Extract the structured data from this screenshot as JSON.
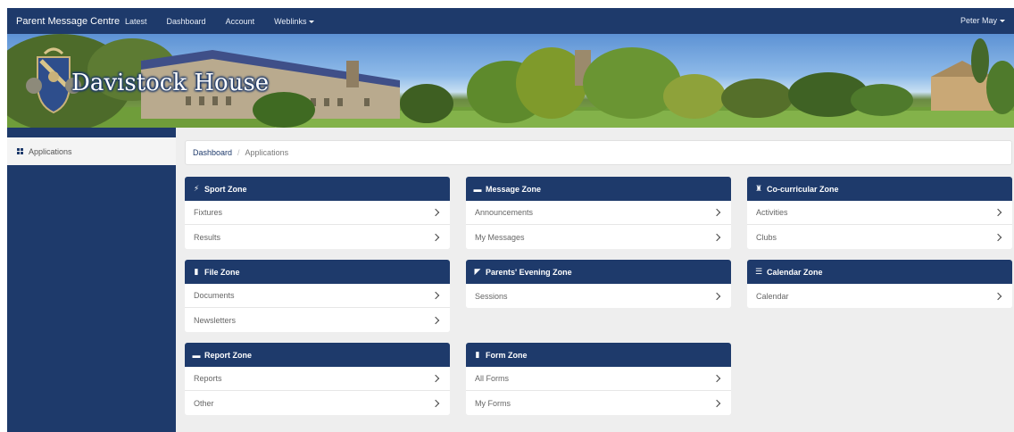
{
  "navbar": {
    "brand": "Parent Message Centre",
    "items": [
      "Latest",
      "Dashboard",
      "Account",
      "Weblinks"
    ],
    "user": "Peter May"
  },
  "banner": {
    "title": "Davistock House"
  },
  "sidebar": {
    "items": [
      {
        "label": "Applications",
        "icon": "grid-icon"
      }
    ]
  },
  "breadcrumb": [
    "Dashboard",
    "Applications"
  ],
  "zones": [
    {
      "title": "Sport Zone",
      "icon": "bolt-icon",
      "items": [
        "Fixtures",
        "Results"
      ]
    },
    {
      "title": "Message Zone",
      "icon": "comment-icon",
      "items": [
        "Announcements",
        "My Messages"
      ]
    },
    {
      "title": "Co-curricular Zone",
      "icon": "trophy-icon",
      "items": [
        "Activities",
        "Clubs"
      ]
    },
    {
      "title": "File Zone",
      "icon": "file-icon",
      "items": [
        "Documents",
        "Newsletters"
      ]
    },
    {
      "title": "Parents' Evening Zone",
      "icon": "bullhorn-icon",
      "items": [
        "Sessions"
      ]
    },
    {
      "title": "Calendar Zone",
      "icon": "calendar-icon",
      "items": [
        "Calendar"
      ]
    },
    {
      "title": "Report Zone",
      "icon": "briefcase-icon",
      "items": [
        "Reports",
        "Other"
      ]
    },
    {
      "title": "Form Zone",
      "icon": "form-icon",
      "items": [
        "All Forms",
        "My Forms"
      ]
    }
  ],
  "colors": {
    "primary": "#1e3a6b",
    "background": "#eeeeee"
  }
}
